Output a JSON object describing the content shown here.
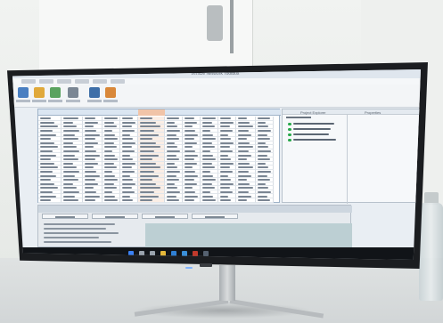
{
  "scene": {
    "description_tag": "photo",
    "app_title": "Vehicle Network Toolbox",
    "colors": {
      "wall": "#eef0ee",
      "desk": "#d6dadb",
      "bezel": "#1b1d20",
      "screen_bg": "#e9eef3",
      "grid_header": "#dbe6f2",
      "selected_column": "#f1c4a8",
      "status_ok": "#27a84a",
      "taskbar": "#111418"
    },
    "ribbon_icons": [
      "save-icon",
      "open-icon",
      "refresh-icon",
      "settings-icon",
      "export-icon",
      "filter-icon",
      "chart-icon"
    ],
    "taskbar_icons": [
      "start-icon",
      "search-icon",
      "taskview-icon",
      "explorer-icon",
      "browser-icon",
      "mail-icon",
      "app-icon",
      "terminal-icon"
    ],
    "right_pane": {
      "col1": "Project Explorer",
      "col2": "Properties"
    }
  }
}
